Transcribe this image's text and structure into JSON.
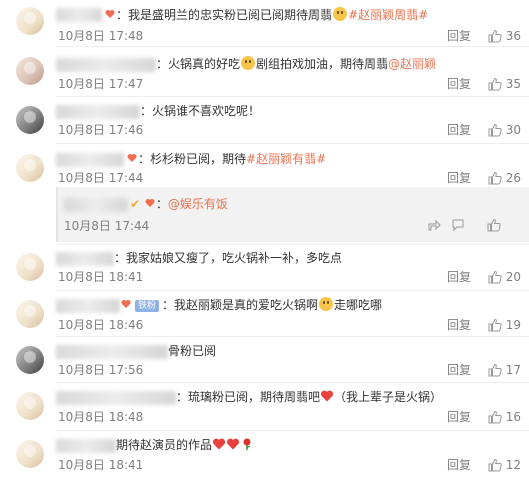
{
  "ui": {
    "reply_label": "回复",
    "like_icon": "thumbs-up-icon"
  },
  "comments": [
    {
      "id": "c1",
      "prefix": "：",
      "text": "我是盛明兰的忠实粉已阅已阅期待周翡",
      "tag": "#赵丽颖周翡#",
      "date": "10月8日",
      "time": "17:48",
      "likes": "36"
    },
    {
      "id": "c2",
      "prefix": "：",
      "text_before": "火锅真的好吃",
      "text_after": "剧组拍戏加油，期待周翡",
      "mention": "@赵丽颖",
      "date": "10月8日",
      "time": "17:47",
      "likes": "35"
    },
    {
      "id": "c3",
      "prefix": "：",
      "text": "火锅谁不喜欢吃呢！",
      "date": "10月8日",
      "time": "17:46",
      "likes": "30"
    },
    {
      "id": "c4",
      "prefix": "：",
      "text": "杉杉粉已阅，期待",
      "tag": "#赵丽颖有翡#",
      "date": "10月8日",
      "time": "17:44",
      "likes": "26"
    },
    {
      "id": "c4r",
      "prefix": "：",
      "mention": "@娱乐有饭",
      "date": "10月8日",
      "time": "17:44"
    },
    {
      "id": "c5",
      "prefix": "：",
      "text": "我家姑娘又瘦了，吃火锅补一补，多吃点",
      "date": "10月8日",
      "time": "18:41",
      "likes": "20"
    },
    {
      "id": "c6",
      "prefix": "：",
      "badge": "铁粉",
      "text_before": "我赵丽颖是真的爱吃火锅啊",
      "text_after": "走哪吃哪",
      "date": "10月8日",
      "time": "18:46",
      "likes": "19"
    },
    {
      "id": "c7",
      "text": "骨粉已阅",
      "date": "10月8日",
      "time": "17:56",
      "likes": "17"
    },
    {
      "id": "c8",
      "prefix": "：",
      "text_before": "琉璃粉已阅，期待周翡吧",
      "text_after": "（我上辈子是火锅）",
      "date": "10月8日",
      "time": "18:48",
      "likes": "16"
    },
    {
      "id": "c9",
      "text": "期待赵演员的作品",
      "date": "10月8日",
      "time": "18:41",
      "likes": "12"
    }
  ]
}
